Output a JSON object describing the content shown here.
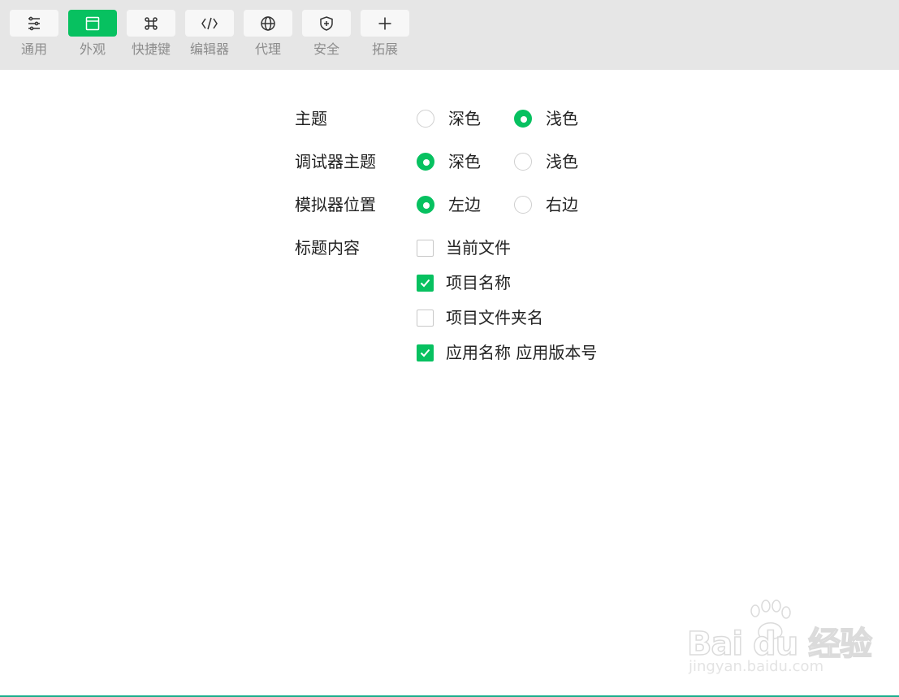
{
  "toolbar": {
    "items": [
      {
        "label": "通用",
        "icon": "sliders-icon",
        "active": false
      },
      {
        "label": "外观",
        "icon": "window-icon",
        "active": true
      },
      {
        "label": "快捷键",
        "icon": "command-key-icon",
        "active": false
      },
      {
        "label": "编辑器",
        "icon": "code-icon",
        "active": false
      },
      {
        "label": "代理",
        "icon": "globe-icon",
        "active": false
      },
      {
        "label": "安全",
        "icon": "shield-icon",
        "active": false
      },
      {
        "label": "拓展",
        "icon": "plus-icon",
        "active": false
      }
    ]
  },
  "settings": {
    "theme": {
      "label": "主题",
      "options": [
        "深色",
        "浅色"
      ],
      "selected": "浅色"
    },
    "debugger_theme": {
      "label": "调试器主题",
      "options": [
        "深色",
        "浅色"
      ],
      "selected": "深色"
    },
    "simulator_position": {
      "label": "模拟器位置",
      "options": [
        "左边",
        "右边"
      ],
      "selected": "左边"
    },
    "title_content": {
      "label": "标题内容",
      "options": [
        {
          "label": "当前文件",
          "checked": false
        },
        {
          "label": "项目名称",
          "checked": true
        },
        {
          "label": "项目文件夹名",
          "checked": false
        },
        {
          "label": "应用名称 应用版本号",
          "checked": true
        }
      ]
    }
  },
  "watermark": {
    "main": "Bai du 经验",
    "sub": "jingyan.baidu.com"
  },
  "colors": {
    "accent": "#07c160",
    "toolbar_bg": "#e6e6e6"
  }
}
